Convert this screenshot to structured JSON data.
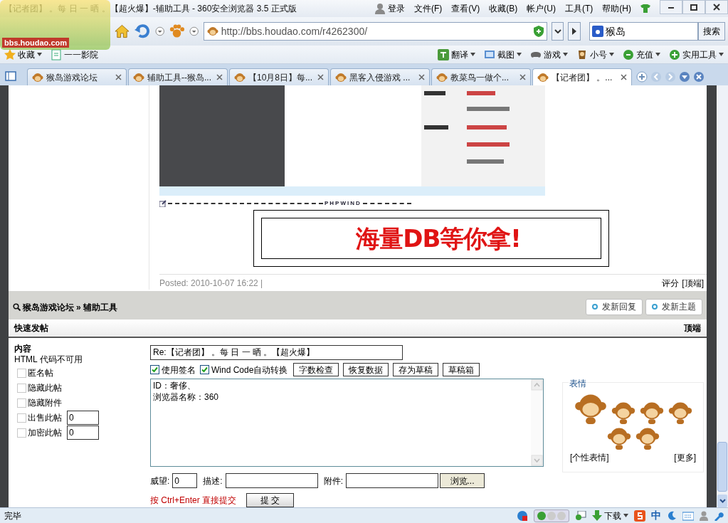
{
  "window": {
    "title": "【记者团】 。每 日 一 晒 。【超火爆】-辅助工具 - 360安全浏览器 3.5 正式版",
    "logo_text": "bbs.houdao.com",
    "login": "登录",
    "menu": [
      "文件(F)",
      "查看(V)",
      "收藏(B)",
      "帐户(U)",
      "工具(T)",
      "帮助(H)"
    ]
  },
  "toolbar": {
    "address": "http://bbs.houdao.com/r4262300/",
    "search_value": "猴岛",
    "search_button": "搜索"
  },
  "favorites_bar": {
    "left": [
      {
        "label": "收藏",
        "dropdown": true
      },
      {
        "label": "一一影院",
        "dropdown": false
      }
    ],
    "right": [
      {
        "label": "翻译",
        "dropdown": true
      },
      {
        "label": "截图",
        "dropdown": true
      },
      {
        "label": "游戏",
        "dropdown": true
      },
      {
        "label": "小号",
        "dropdown": true
      },
      {
        "label": "充值",
        "dropdown": true
      },
      {
        "label": "实用工具",
        "dropdown": true
      }
    ]
  },
  "tabs": [
    {
      "label": "猴岛游戏论坛",
      "selected": false
    },
    {
      "label": "辅助工具--猴岛...",
      "selected": false
    },
    {
      "label": "【10月8日】每...",
      "selected": false
    },
    {
      "label": "黑客入侵游戏 ...",
      "selected": false
    },
    {
      "label": "教菜鸟一做个...",
      "selected": false
    },
    {
      "label": "【记者团】 。...",
      "selected": true
    }
  ],
  "post": {
    "signature_label": "PHPWIND",
    "banner": "海量DB等你拿!",
    "posted": "Posted: 2010-10-07 16:22 |",
    "actions": [
      "评分",
      "[顶端]"
    ]
  },
  "breadcrumb": {
    "forum": "猴岛游戏论坛",
    "separator": "»",
    "board": "辅助工具",
    "buttons": [
      "发新回复",
      "发新主题"
    ]
  },
  "quick_post": {
    "title": "快速发帖",
    "top_link": "顶端",
    "content_label": "内容",
    "html_note": "HTML 代码不可用",
    "options": [
      {
        "label": "匿名帖",
        "checked": false
      },
      {
        "label": "隐藏此帖",
        "checked": false
      },
      {
        "label": "隐藏附件",
        "checked": false
      },
      {
        "label": "出售此帖",
        "checked": false,
        "value": "0"
      },
      {
        "label": "加密此帖",
        "checked": false,
        "value": "0"
      }
    ],
    "subject": "Re:【记者团】 。每 日 一 晒 。【超火爆】",
    "toggles": [
      {
        "label": "使用签名",
        "checked": true
      },
      {
        "label": "Wind Code自动转换",
        "checked": true
      }
    ],
    "tool_buttons": [
      "字数检查",
      "恢复数据",
      "存为草稿",
      "草稿箱"
    ],
    "body_lines": [
      "ID：奢侈、",
      "浏览器名称：360"
    ],
    "emoticons": {
      "title": "表情",
      "links": [
        "[个性表情]",
        "[更多]"
      ]
    },
    "fields": [
      {
        "label": "威望:",
        "value": "0"
      },
      {
        "label": "描述:"
      },
      {
        "label": "附件:"
      }
    ],
    "browse_button": "浏览...",
    "hint": "按 Ctrl+Enter 直接提交",
    "submit": "提 交"
  },
  "status_bar": {
    "text": "完毕",
    "download": "下载",
    "ime": "中"
  }
}
